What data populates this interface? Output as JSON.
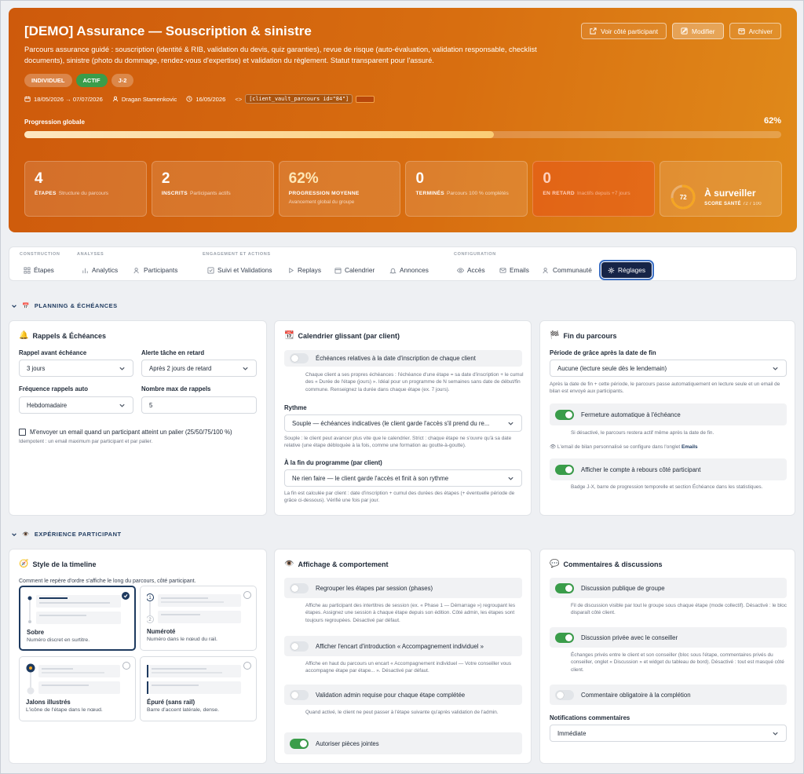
{
  "hero": {
    "title": "[DEMO] Assurance — Souscription & sinistre",
    "description": "Parcours assurance guidé : souscription (identité & RIB, validation du devis, quiz garanties), revue de risque (auto-évaluation, validation responsable, checklist documents), sinistre (photo du dommage, rendez-vous d'expertise) et validation du règlement. Statut transparent pour l'assuré.",
    "buttons": {
      "view": "Voir côté participant",
      "edit": "Modifier",
      "archive": "Archiver"
    },
    "pills": [
      "INDIVIDUEL",
      "ACTIF",
      "J-2"
    ],
    "meta": {
      "dates": "18/05/2026 → 07/07/2026",
      "author": "Dragan Stamenkovic",
      "created": "16/05/2026",
      "code_prefix": "<>",
      "code": "[client_vault_parcours id=\"84\"]"
    },
    "progress": {
      "label": "Progression globale",
      "value_text": "62%",
      "value": 62
    },
    "stats": [
      {
        "value": "4",
        "label": "ÉTAPES",
        "sub": "Structure du parcours"
      },
      {
        "value": "2",
        "label": "INSCRITS",
        "sub": "Participants actifs"
      },
      {
        "value": "62%",
        "label": "PROGRESSION MOYENNE",
        "note": "Avancement global du groupe"
      },
      {
        "value": "0",
        "label": "TERMINÉS",
        "sub": "Parcours 100 % complétés"
      },
      {
        "value": "0",
        "label": "EN RETARD",
        "sub": "Inactifs depuis +7 jours"
      }
    ],
    "health": {
      "score": "72",
      "score_value": 72,
      "status": "À surveiller",
      "label": "SCORE SANTÉ",
      "detail": "72 / 100"
    }
  },
  "nav": {
    "groups": [
      "CONSTRUCTION",
      "ANALYSES",
      "ENGAGEMENT ET ACTIONS",
      "CONFIGURATION"
    ],
    "items": [
      "Étapes",
      "Analytics",
      "Participants",
      "Suivi et Validations",
      "Replays",
      "Calendrier",
      "Annonces",
      "Accès",
      "Emails",
      "Communauté",
      "Réglages"
    ]
  },
  "sections": {
    "planning": "PLANNING & ÉCHÉANCES",
    "experience": "EXPÉRIENCE PARTICIPANT"
  },
  "rappels": {
    "title": "Rappels & Échéances",
    "reminder_label": "Rappel avant échéance",
    "reminder_value": "3 jours",
    "late_label": "Alerte tâche en retard",
    "late_value": "Après 2 jours de retard",
    "freq_label": "Fréquence rappels auto",
    "freq_value": "Hebdomadaire",
    "max_label": "Nombre max de rappels",
    "max_value": "5",
    "milestone_label": "M'envoyer un email quand un participant atteint un palier (25/50/75/100 %)",
    "milestone_hint": "Idempotent : un email maximum par participant et par palier."
  },
  "calendrier": {
    "title": "Calendrier glissant (par client)",
    "relative_label": "Échéances relatives à la date d'inscription de chaque client",
    "relative_hint": "Chaque client a ses propres échéances : l'échéance d'une étape = sa date d'inscription + le cumul des « Durée de l'étape (jours) ». Idéal pour un programme de N semaines sans date de début/fin commune. Renseignez la durée dans chaque étape (ex. 7 jours).",
    "rythme_label": "Rythme",
    "rythme_value": "Souple — échéances indicatives (le client garde l'accès s'il prend du re...",
    "rythme_hint": "Souple : le client peut avancer plus vite que le calendrier. Strict : chaque étape ne s'ouvre qu'à sa date relative (une étape débloquée à la fois, comme une formation au goutte-à-goutte).",
    "end_label": "À la fin du programme (par client)",
    "end_value": "Ne rien faire — le client garde l'accès et finit à son rythme",
    "end_hint": "La fin est calculée par client : date d'inscription + cumul des durées des étapes (+ éventuelle période de grâce ci-dessous). Vérifié une fois par jour."
  },
  "fin": {
    "title": "Fin du parcours",
    "grace_label": "Période de grâce après la date de fin",
    "grace_value": "Aucune (lecture seule dès le lendemain)",
    "grace_hint": "Après la date de fin + cette période, le parcours passe automatiquement en lecture seule et un email de bilan est envoyé aux participants.",
    "auto_close": "Fermeture automatique à l'échéance",
    "auto_close_hint": "Si désactivé, le parcours restera actif même après la date de fin.",
    "email_hint_prefix": "L'email de bilan personnalisé se configure dans l'onglet",
    "email_hint_link": "Emails",
    "countdown": "Afficher le compte à rebours côté participant",
    "countdown_hint": "Badge J-X, barre de progression temporelle et section Échéance dans les statistiques."
  },
  "timeline": {
    "title": "Style de la timeline",
    "subtitle": "Comment le repère d'ordre s'affiche le long du parcours, côté participant.",
    "options": [
      {
        "name": "Sobre",
        "desc": "Numéro discret en surtitre."
      },
      {
        "name": "Numéroté",
        "desc": "Numéro dans le nœud du rail."
      },
      {
        "name": "Jalons illustrés",
        "desc": "L'icône de l'étape dans le nœud."
      },
      {
        "name": "Épuré (sans rail)",
        "desc": "Barre d'accent latérale, dense."
      }
    ],
    "numbers": [
      "1",
      "2"
    ]
  },
  "affichage": {
    "title": "Affichage & comportement",
    "group_label": "Regrouper les étapes par session (phases)",
    "group_hint": "Affiche au participant des intertitres de session (ex. « Phase 1 — Démarrage ») regroupant les étapes. Assignez une session à chaque étape depuis son édition. Côté admin, les étapes sont toujours regroupées. Désactivé par défaut.",
    "intro_label": "Afficher l'encart d'introduction « Accompagnement individuel »",
    "intro_hint": "Affiche en haut du parcours un encart « Accompagnement individuel — Votre conseiller vous accompagne étape par étape... ». Désactivé par défaut.",
    "admin_label": "Validation admin requise pour chaque étape complétée",
    "admin_hint": "Quand activé, le client ne peut passer à l'étape suivante qu'après validation de l'admin.",
    "attach_label": "Autoriser pièces jointes"
  },
  "commentaires": {
    "title": "Commentaires & discussions",
    "public_label": "Discussion publique de groupe",
    "public_hint": "Fil de discussion visible par tout le groupe sous chaque étape (mode collectif). Désactivé : le bloc disparaît côté client.",
    "private_label": "Discussion privée avec le conseiller",
    "private_hint": "Échanges privés entre le client et son conseiller (bloc sous l'étape, commentaires privés du conseiller, onglet « Discussion » et widget du tableau de bord). Désactivé : tout est masqué côté client.",
    "required_label": "Commentaire obligatoire à la complétion",
    "notif_label": "Notifications commentaires",
    "notif_value": "Immédiate"
  },
  "colors": {
    "accent": "#1e3a5f",
    "hero_from": "#ce5a0c",
    "hero_to": "#e08a1a",
    "toggle_on": "#3a9d4a",
    "ring": "#f5a623"
  }
}
